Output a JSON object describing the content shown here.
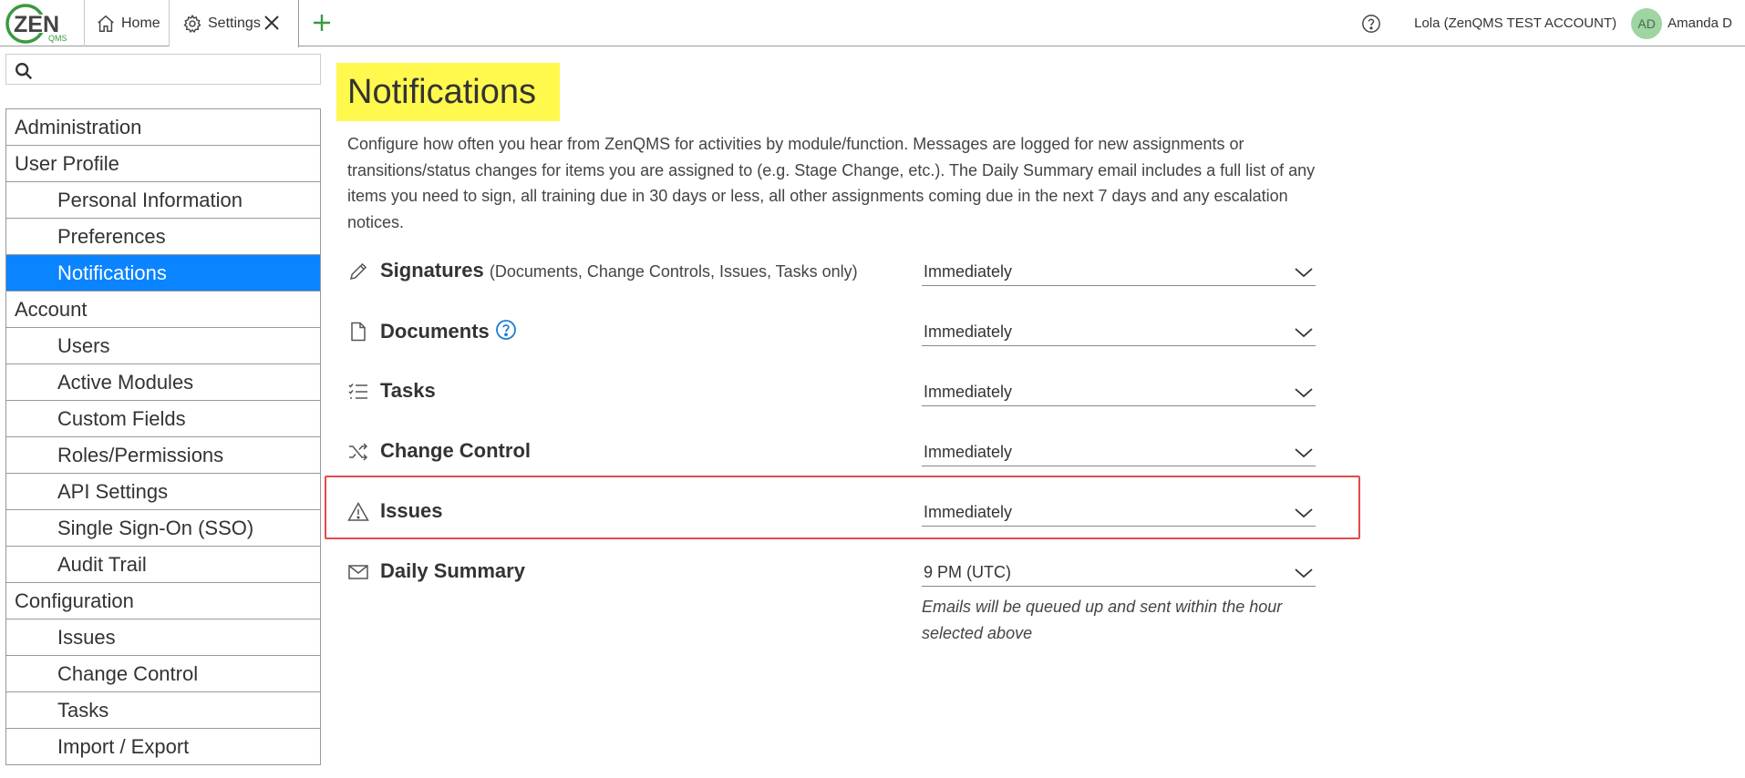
{
  "header": {
    "logo_text": "ZEN",
    "logo_sub": "QMS",
    "tabs": [
      {
        "label": "Home",
        "icon": "home-icon"
      },
      {
        "label": "Settings",
        "icon": "gear-icon"
      }
    ],
    "account_label": "Lola (ZenQMS TEST ACCOUNT)",
    "avatar_initials": "AD",
    "user_name": "Amanda D",
    "colors": {
      "accent_green": "#3a9a3f",
      "avatar_bg": "#9fd4a3"
    }
  },
  "search": {
    "value": "",
    "placeholder": ""
  },
  "sidebar": {
    "items": [
      {
        "label": "Administration"
      },
      {
        "label": "User Profile"
      },
      {
        "label": "Personal Information"
      },
      {
        "label": "Preferences"
      },
      {
        "label": "Notifications"
      },
      {
        "label": "Account"
      },
      {
        "label": "Users"
      },
      {
        "label": "Active Modules"
      },
      {
        "label": "Custom Fields"
      },
      {
        "label": "Roles/Permissions"
      },
      {
        "label": "API Settings"
      },
      {
        "label": "Single Sign-On (SSO)"
      },
      {
        "label": "Audit Trail"
      },
      {
        "label": "Configuration"
      },
      {
        "label": "Issues"
      },
      {
        "label": "Change Control"
      },
      {
        "label": "Tasks"
      },
      {
        "label": "Import / Export"
      }
    ],
    "active_color": "#0a84ff"
  },
  "main": {
    "title": "Notifications",
    "title_highlight": "#fff94d",
    "intro": "Configure how often you hear from ZenQMS for activities by module/function. Messages are logged for new assignments or transitions/status changes for items you are assigned to (e.g. Stage Change, etc.). The Daily Summary email includes a full list of any items you need to sign, all training due in 30 days or less, all other assignments coming due in the next 7 days and any escalation notices.",
    "rows": [
      {
        "label": "Signatures",
        "sub": "(Documents, Change Controls, Issues, Tasks only)",
        "icon": "pencil-icon",
        "value": "Immediately"
      },
      {
        "label": "Documents",
        "icon": "document-icon",
        "value": "Immediately"
      },
      {
        "label": "Tasks",
        "icon": "checklist-icon",
        "value": "Immediately"
      },
      {
        "label": "Change Control",
        "icon": "shuffle-icon",
        "value": "Immediately"
      },
      {
        "label": "Issues",
        "icon": "warning-icon",
        "value": "Immediately"
      },
      {
        "label": "Daily Summary",
        "icon": "envelope-icon",
        "value": "9 PM (UTC)"
      }
    ],
    "daily_note": "Emails will be queued up and sent within the hour selected above",
    "highlight_color": "#e34b4b"
  }
}
